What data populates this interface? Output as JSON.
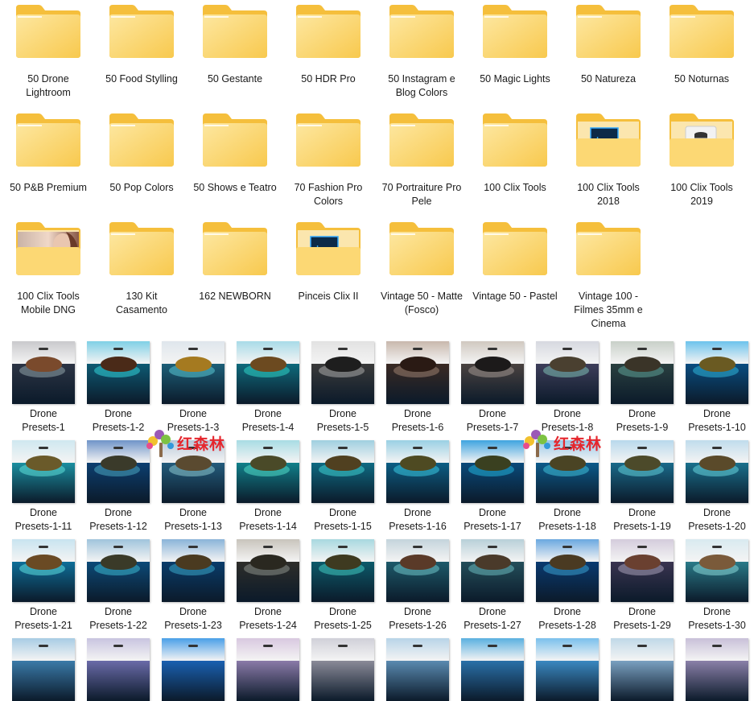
{
  "folders": [
    {
      "label": "50 Drone Lightroom",
      "type": "plain"
    },
    {
      "label": "50 Food Stylling",
      "type": "plain"
    },
    {
      "label": "50 Gestante",
      "type": "plain"
    },
    {
      "label": "50 HDR Pro",
      "type": "plain"
    },
    {
      "label": "50 Instagram e Blog Colors",
      "type": "plain"
    },
    {
      "label": "50 Magic Lights",
      "type": "plain"
    },
    {
      "label": "50 Natureza",
      "type": "plain"
    },
    {
      "label": "50 Noturnas",
      "type": "plain"
    },
    {
      "label": "50 P&B Premium",
      "type": "plain"
    },
    {
      "label": "50 Pop Colors",
      "type": "plain"
    },
    {
      "label": "50 Shows e Teatro",
      "type": "plain"
    },
    {
      "label": "70 Fashion Pro Colors",
      "type": "plain"
    },
    {
      "label": "70 Portraiture Pro Pele",
      "type": "plain"
    },
    {
      "label": "100 Clix Tools",
      "type": "plain"
    },
    {
      "label": "100 Clix Tools 2018",
      "type": "lrc"
    },
    {
      "label": "100 Clix Tools 2019",
      "type": "database"
    },
    {
      "label": "100 Clix Tools Mobile DNG",
      "type": "photo"
    },
    {
      "label": "130 Kit Casamento",
      "type": "plain"
    },
    {
      "label": "162 NEWBORN",
      "type": "plain"
    },
    {
      "label": "Pinceis Clix II",
      "type": "lrc"
    },
    {
      "label": "Vintage 50 - Matte (Fosco)",
      "type": "plain"
    },
    {
      "label": "Vintage 50 - Pastel",
      "type": "plain"
    },
    {
      "label": "Vintage 100 - Filmes 35mm e Cinema",
      "type": "plain"
    }
  ],
  "lrc_badge": "Lrc",
  "thumb_prefix": "Drone",
  "thumbnails": [
    {
      "label": "Presets-1",
      "sky": "#c9c9cc",
      "sea": "#2c3444",
      "island": "#7a4a2c",
      "reef": "#8fa3a8"
    },
    {
      "label": "Presets-1-2",
      "sky": "#7fd0e6",
      "sea": "#0e5a73",
      "island": "#4a2a18",
      "reef": "#33d3d8"
    },
    {
      "label": "Presets-1-3",
      "sky": "#dfe6ec",
      "sea": "#1d5f78",
      "island": "#a57a20",
      "reef": "#5ac6d2"
    },
    {
      "label": "Presets-1-4",
      "sky": "#a8dbe8",
      "sea": "#0f6a7c",
      "island": "#6c4a20",
      "reef": "#2fd3c6"
    },
    {
      "label": "Presets-1-5",
      "sky": "#e2e2e2",
      "sea": "#3a3a3a",
      "island": "#1e1e1e",
      "reef": "#aaaaaa"
    },
    {
      "label": "Presets-1-6",
      "sky": "#c8b8ad",
      "sea": "#3a2a24",
      "island": "#2a1a14",
      "reef": "#9a8070"
    },
    {
      "label": "Presets-1-7",
      "sky": "#d0c8c0",
      "sea": "#4a4240",
      "island": "#1c1a1a",
      "reef": "#a09590"
    },
    {
      "label": "Presets-1-8",
      "sky": "#d6d8e0",
      "sea": "#3e3e5a",
      "island": "#4a4030",
      "reef": "#7fc0b5"
    },
    {
      "label": "Presets-1-9",
      "sky": "#c8d0c8",
      "sea": "#2a4040",
      "island": "#3a3428",
      "reef": "#5fa095"
    },
    {
      "label": "Presets-1-10",
      "sky": "#6cc3ec",
      "sea": "#0a4d80",
      "island": "#6a5a22",
      "reef": "#2fb4d8"
    },
    {
      "label": "Presets-1-11",
      "sky": "#cfe8f0",
      "sea": "#1b8fa0",
      "island": "#6a5a2a",
      "reef": "#5ee0d8"
    },
    {
      "label": "Presets-1-12",
      "sky": "#6f94c8",
      "sea": "#0d3f70",
      "island": "#3a3a2a",
      "reef": "#4aa6c0"
    },
    {
      "label": "Presets-1-13",
      "sky": "#b8c8d8",
      "sea": "#245c7c",
      "island": "#5a4a30",
      "reef": "#8cc8d0"
    },
    {
      "label": "Presets-1-14",
      "sky": "#a8dce4",
      "sea": "#11808a",
      "island": "#4a4a28",
      "reef": "#52dcc8"
    },
    {
      "label": "Presets-1-15",
      "sky": "#a0cfe0",
      "sea": "#0e6a82",
      "island": "#504020",
      "reef": "#40d0d0"
    },
    {
      "label": "Presets-1-16",
      "sky": "#9ad0e4",
      "sea": "#0c5e84",
      "island": "#4e4a22",
      "reef": "#3ac8e0"
    },
    {
      "label": "Presets-1-17",
      "sky": "#3fa4e0",
      "sea": "#0a4a7a",
      "island": "#3a4020",
      "reef": "#22b0d8"
    },
    {
      "label": "Presets-1-18",
      "sky": "#9ac8e8",
      "sea": "#0d5a8a",
      "island": "#4a4424",
      "reef": "#40c0d8"
    },
    {
      "label": "Presets-1-19",
      "sky": "#b8d8ec",
      "sea": "#1a6a8a",
      "island": "#4c4a2a",
      "reef": "#62d0d8"
    },
    {
      "label": "Presets-1-20",
      "sky": "#c0dcec",
      "sea": "#1a708c",
      "island": "#5a4a2a",
      "reef": "#68d4dc"
    },
    {
      "label": "Presets-1-21",
      "sky": "#c8e4f0",
      "sea": "#0e6e98",
      "island": "#6a4a24",
      "reef": "#5ee0e0"
    },
    {
      "label": "Presets-1-22",
      "sky": "#a0c4dc",
      "sea": "#0c4a78",
      "island": "#3a3a28",
      "reef": "#3cb8d0"
    },
    {
      "label": "Presets-1-23",
      "sky": "#8ab4d8",
      "sea": "#0a3c6a",
      "island": "#4a3a20",
      "reef": "#3aa8c8"
    },
    {
      "label": "Presets-1-24",
      "sky": "#c8c4bc",
      "sea": "#2e2e2a",
      "island": "#2a2820",
      "reef": "#8a9088"
    },
    {
      "label": "Presets-1-25",
      "sky": "#a8d8e0",
      "sea": "#0c5a6a",
      "island": "#3e3a20",
      "reef": "#42c8c0"
    },
    {
      "label": "Presets-1-26",
      "sky": "#c4d4dc",
      "sea": "#1e5a6a",
      "island": "#5a3a28",
      "reef": "#70c4c8"
    },
    {
      "label": "Presets-1-27",
      "sky": "#b8d0d8",
      "sea": "#244e5a",
      "island": "#4a3a2a",
      "reef": "#6ab8bc"
    },
    {
      "label": "Presets-1-28",
      "sky": "#6aa8e0",
      "sea": "#0a3a70",
      "island": "#4a3a22",
      "reef": "#3aa0d0"
    },
    {
      "label": "Presets-1-29",
      "sky": "#d4ccdc",
      "sea": "#3a3450",
      "island": "#6a4030",
      "reef": "#a8a0b8"
    },
    {
      "label": "Presets-1-30",
      "sky": "#d8eaf0",
      "sea": "#2a7a88",
      "island": "#7a5a3a",
      "reef": "#8ad8d8"
    },
    {
      "label": "",
      "sky": "#a8cce4",
      "sea": "#3a7aa8",
      "island": "#000000",
      "reef": "#000000"
    },
    {
      "label": "",
      "sky": "#c8c4e0",
      "sea": "#6a6aa8",
      "island": "#000000",
      "reef": "#000000"
    },
    {
      "label": "",
      "sky": "#4aa0e8",
      "sea": "#1a60b0",
      "island": "#000000",
      "reef": "#000000"
    },
    {
      "label": "",
      "sky": "#d8c8e0",
      "sea": "#8a7aa8",
      "island": "#000000",
      "reef": "#000000"
    },
    {
      "label": "",
      "sky": "#d0d0d8",
      "sea": "#8a8a98",
      "island": "#000000",
      "reef": "#000000"
    },
    {
      "label": "",
      "sky": "#b8d4e8",
      "sea": "#5a8ab0",
      "island": "#000000",
      "reef": "#000000"
    },
    {
      "label": "",
      "sky": "#5ab0e0",
      "sea": "#2a70a8",
      "island": "#000000",
      "reef": "#000000"
    },
    {
      "label": "",
      "sky": "#7ac0ec",
      "sea": "#3a88c0",
      "island": "#000000",
      "reef": "#000000"
    },
    {
      "label": "",
      "sky": "#c0d8e8",
      "sea": "#7aa0c0",
      "island": "#000000",
      "reef": "#000000"
    },
    {
      "label": "",
      "sky": "#c8c0d8",
      "sea": "#8a80a8",
      "island": "#000000",
      "reef": "#000000"
    }
  ],
  "watermark": {
    "text": "红森林"
  },
  "colors": {
    "folder_back": "#f5bf3c",
    "folder_front": "#fcd874",
    "folder_front2": "#f8c94e"
  }
}
